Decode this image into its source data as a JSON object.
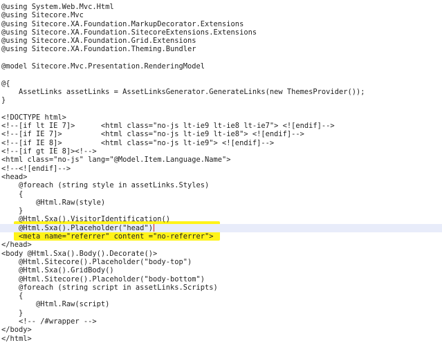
{
  "editor": {
    "lines": [
      "@using System.Web.Mvc.Html",
      "@using Sitecore.Mvc",
      "@using Sitecore.XA.Foundation.MarkupDecorator.Extensions",
      "@using Sitecore.XA.Foundation.SitecoreExtensions.Extensions",
      "@using Sitecore.XA.Foundation.Grid.Extensions",
      "@using Sitecore.XA.Foundation.Theming.Bundler",
      "",
      "@model Sitecore.Mvc.Presentation.RenderingModel",
      "",
      "@{",
      "    AssetLinks assetLinks = AssetLinksGenerator.GenerateLinks(new ThemesProvider());",
      "}",
      "",
      "<!DOCTYPE html>",
      "<!--[if lt IE 7]>      <html class=\"no-js lt-ie9 lt-ie8 lt-ie7\"> <![endif]-->",
      "<!--[if IE 7]>         <html class=\"no-js lt-ie9 lt-ie8\"> <![endif]-->",
      "<!--[if IE 8]>         <html class=\"no-js lt-ie9\"> <![endif]-->",
      "<!--[if gt IE 8]><!-->",
      "<html class=\"no-js\" lang=\"@Model.Item.Language.Name\">",
      "<!--<![endif]-->",
      "<head>",
      "    @foreach (string style in assetLinks.Styles)",
      "    {",
      "        @Html.Raw(style)",
      "    }",
      "    @Html.Sxa().VisitorIdentification()",
      "    @Html.Sxa().Placeholder(\"head\")",
      "    <meta name=\"referrer\" content =\"no-referrer\">",
      "</head>",
      "<body @Html.Sxa().Body().Decorate()>",
      "    @Html.Sitecore().Placeholder(\"body-top\")",
      "    @Html.Sxa().GridBody()",
      "    @Html.Sitecore().Placeholder(\"body-bottom\")",
      "    @foreach (string script in assetLinks.Scripts)",
      "    {",
      "        @Html.Raw(script)",
      "    }",
      "    <!-- /#wrapper -->",
      "</body>",
      "</html>"
    ],
    "current_line": 26,
    "colors": {
      "background": "#ffffff",
      "text": "#1e1e1e",
      "current_line": "#e8ecfa",
      "annotation_highlight": "#fff200",
      "caret": "#d81b1b"
    }
  }
}
